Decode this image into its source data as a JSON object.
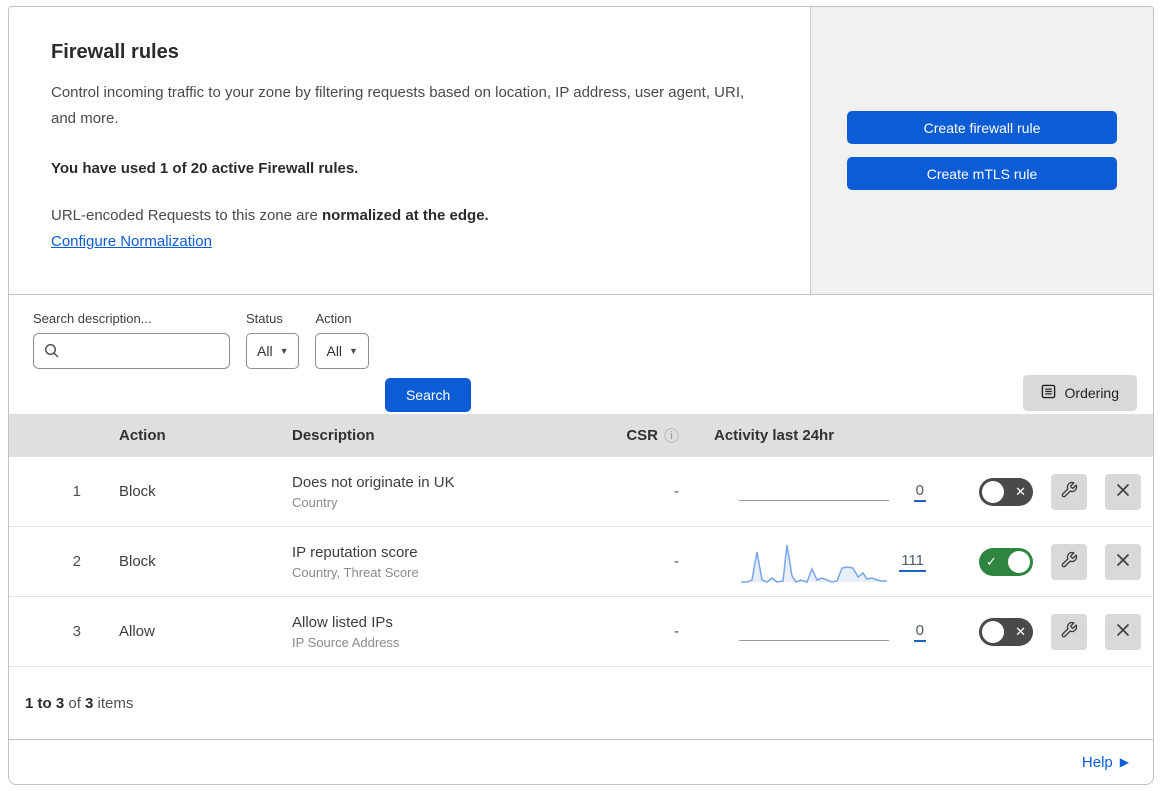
{
  "header": {
    "title": "Firewall rules",
    "description": "Control incoming traffic to your zone by filtering requests based on location, IP address, user agent, URI, and more.",
    "usage": "You have used 1 of 20 active Firewall rules.",
    "normalization_text": "URL-encoded Requests to this zone are ",
    "normalization_bold": "normalized at the edge.",
    "normalization_link": "Configure Normalization",
    "create_firewall_button": "Create firewall rule",
    "create_mtls_button": "Create mTLS rule"
  },
  "filters": {
    "search_label": "Search description...",
    "search_value": "",
    "status_label": "Status",
    "status_value": "All",
    "action_label": "Action",
    "action_value": "All",
    "search_button": "Search",
    "ordering_button": "Ordering"
  },
  "icons": {
    "caret_down": "▼",
    "info": "ⓘ",
    "help_arrow": "▶",
    "toggle_on": "✓",
    "toggle_off": "✕"
  },
  "table": {
    "columns": {
      "action": "Action",
      "description": "Description",
      "csr": "CSR",
      "activity": "Activity last 24hr"
    },
    "rows": [
      {
        "index": "1",
        "action": "Block",
        "description": "Does not originate in UK",
        "fields": "Country",
        "csr": "-",
        "activity_count": "0",
        "enabled": false,
        "sparkline": null
      },
      {
        "index": "2",
        "action": "Block",
        "description": "IP reputation score",
        "fields": "Country, Threat Score",
        "csr": "-",
        "activity_count": "111",
        "enabled": true,
        "sparkline": [
          [
            2,
            42
          ],
          [
            8,
            42
          ],
          [
            13,
            40
          ],
          [
            18,
            12
          ],
          [
            23,
            40
          ],
          [
            28,
            42
          ],
          [
            33,
            38
          ],
          [
            38,
            42
          ],
          [
            44,
            41
          ],
          [
            48,
            5
          ],
          [
            53,
            36
          ],
          [
            57,
            42
          ],
          [
            62,
            40
          ],
          [
            68,
            42
          ],
          [
            73,
            29
          ],
          [
            78,
            40
          ],
          [
            83,
            38
          ],
          [
            88,
            40
          ],
          [
            93,
            42
          ],
          [
            98,
            41
          ],
          [
            103,
            28
          ],
          [
            109,
            27
          ],
          [
            114,
            28
          ],
          [
            119,
            37
          ],
          [
            124,
            33
          ],
          [
            128,
            39
          ],
          [
            133,
            38
          ],
          [
            138,
            40
          ],
          [
            143,
            41
          ],
          [
            148,
            41
          ]
        ]
      },
      {
        "index": "3",
        "action": "Allow",
        "description": "Allow listed IPs",
        "fields": "IP Source Address",
        "csr": "-",
        "activity_count": "0",
        "enabled": false,
        "sparkline": null
      }
    ]
  },
  "footer": {
    "range": "1 to 3",
    "of_text": " of ",
    "total": "3",
    "items_text": " items",
    "help_label": "Help"
  },
  "colors": {
    "primary_blue": "#0b5cd5",
    "link_blue": "#0b5cd5",
    "toggle_on_green": "#2e8540",
    "toggle_off_gray": "#4a4a4a",
    "sparkline_stroke": "#78a5ea",
    "sparkline_fill": "#e8effb",
    "table_header_bg": "#dfdfdf",
    "panel_gray": "#f1f1f1"
  }
}
